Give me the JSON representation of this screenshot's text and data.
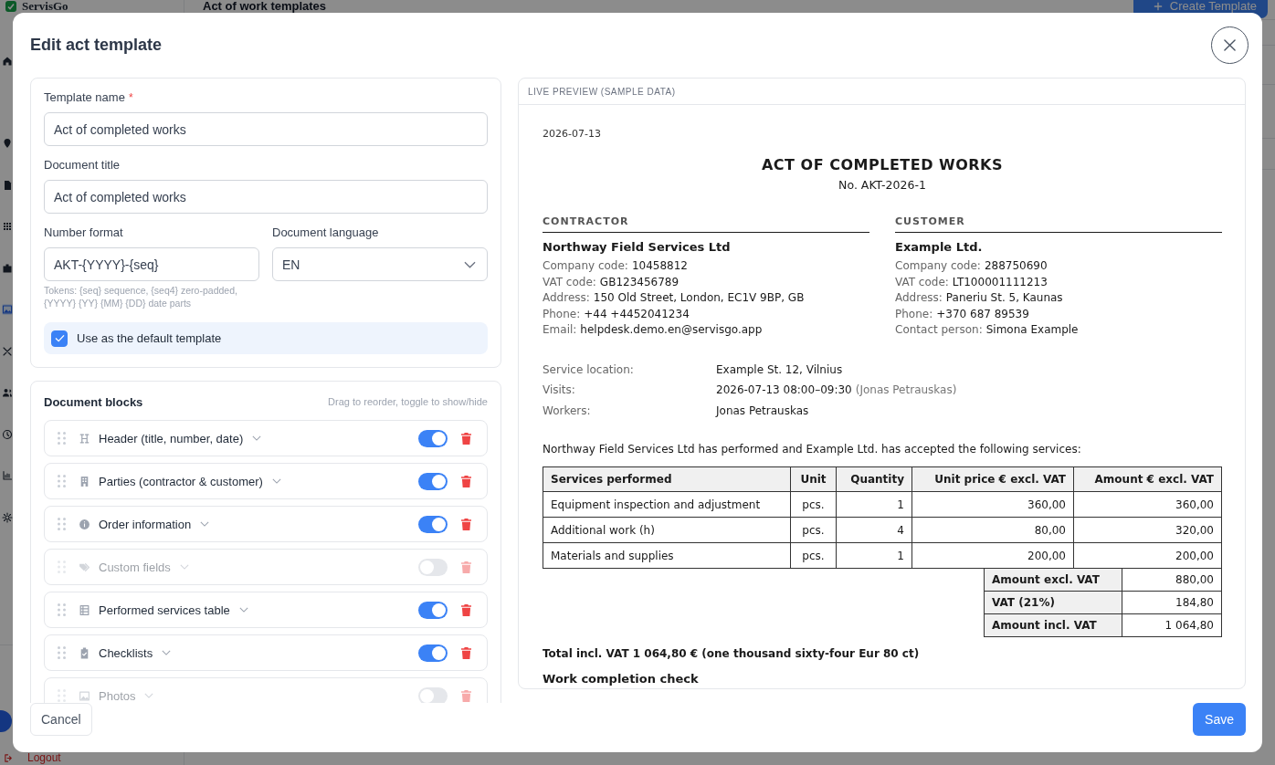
{
  "app": {
    "logo": "ServisGo",
    "page_title": "Act of work templates",
    "create_button": "Create Template",
    "sidebar": {
      "items": [
        {
          "selected": false
        },
        {
          "selected": false
        },
        {
          "selected": false
        },
        {
          "selected": false
        },
        {
          "selected": false
        },
        {
          "selected": true
        },
        {
          "selected": false
        },
        {
          "selected": false
        },
        {
          "selected": false
        },
        {
          "selected": false
        },
        {
          "selected": false
        }
      ]
    },
    "logout": "Logout"
  },
  "dialog": {
    "title": "Edit act template"
  },
  "form": {
    "template_name": {
      "label": "Template name",
      "required_mark": "*",
      "value": "Act of completed works"
    },
    "document_title": {
      "label": "Document title",
      "value": "Act of completed works"
    },
    "number_format": {
      "label": "Number format",
      "value": "AKT-{YYYY}-{seq}",
      "hint": "Tokens: {seq} sequence, {seq4} zero-padded, {YYYY} {YY} {MM} {DD} date parts"
    },
    "document_language": {
      "label": "Document language",
      "value": "EN"
    },
    "default_template": {
      "label": "Use as the default template",
      "checked": true
    }
  },
  "blocks": {
    "title": "Document blocks",
    "hint": "Drag to reorder, toggle to show/hide",
    "items": [
      {
        "kind": "header",
        "label": "Header (title, number, date)",
        "enabled": true
      },
      {
        "kind": "parties",
        "label": "Parties (contractor & customer)",
        "enabled": true
      },
      {
        "kind": "order",
        "label": "Order information",
        "enabled": true
      },
      {
        "kind": "fields",
        "label": "Custom fields",
        "enabled": false
      },
      {
        "kind": "services",
        "label": "Performed services table",
        "enabled": true
      },
      {
        "kind": "checklists",
        "label": "Checklists",
        "enabled": true
      },
      {
        "kind": "photos",
        "label": "Photos",
        "enabled": false
      }
    ]
  },
  "preview": {
    "heading": "LIVE PREVIEW (SAMPLE DATA)",
    "date": "2026-07-13",
    "title": "ACT OF COMPLETED WORKS",
    "number": "No. AKT-2026-1",
    "parties": [
      {
        "heading": "CONTRACTOR",
        "name": "Northway Field Services Ltd",
        "lines": [
          {
            "label": "Company code:",
            "value": "10458812"
          },
          {
            "label": "VAT code:",
            "value": "GB123456789"
          },
          {
            "label": "Address:",
            "value": "150 Old Street, London, EC1V 9BP, GB"
          },
          {
            "label": "Phone:",
            "value": "+44 +4452041234"
          },
          {
            "label": "Email:",
            "value": "helpdesk.demo.en@servisgo.app"
          }
        ]
      },
      {
        "heading": "CUSTOMER",
        "name": "Example Ltd.",
        "lines": [
          {
            "label": "Company code:",
            "value": "288750690"
          },
          {
            "label": "VAT code:",
            "value": "LT100001111213"
          },
          {
            "label": "Address:",
            "value": "Paneriu St. 5, Kaunas"
          },
          {
            "label": "Phone:",
            "value": "+370 687 89539"
          },
          {
            "label": "Contact person:",
            "value": "Simona Example"
          }
        ]
      }
    ],
    "order_info": [
      {
        "label": "Service location:",
        "value": "Example St. 12, Vilnius"
      },
      {
        "label": "Visits:",
        "value": "2026-07-13 08:00–09:30",
        "note": "(Jonas Petrauskas)"
      },
      {
        "label": "Workers:",
        "value": "Jonas Petrauskas"
      }
    ],
    "intro": "Northway Field Services Ltd has performed and Example Ltd. has accepted the following services:",
    "services_table": {
      "columns": [
        "Services performed",
        "Unit",
        "Quantity",
        "Unit price € excl. VAT",
        "Amount € excl. VAT"
      ],
      "rows": [
        [
          "Equipment inspection and adjustment",
          "pcs.",
          "1",
          "360,00",
          "360,00"
        ],
        [
          "Additional work (h)",
          "pcs.",
          "4",
          "80,00",
          "320,00"
        ],
        [
          "Materials and supplies",
          "pcs.",
          "1",
          "200,00",
          "200,00"
        ]
      ]
    },
    "totals": [
      {
        "label": "Amount excl. VAT",
        "value": "880,00"
      },
      {
        "label": "VAT (21%)",
        "value": "184,80"
      },
      {
        "label": "Amount incl. VAT",
        "value": "1 064,80"
      }
    ],
    "total_in_words": "Total incl. VAT 1 064,80 € (one thousand sixty-four Eur 80 ct)",
    "next_section": "Work completion check"
  },
  "footer": {
    "cancel": "Cancel",
    "save": "Save"
  }
}
